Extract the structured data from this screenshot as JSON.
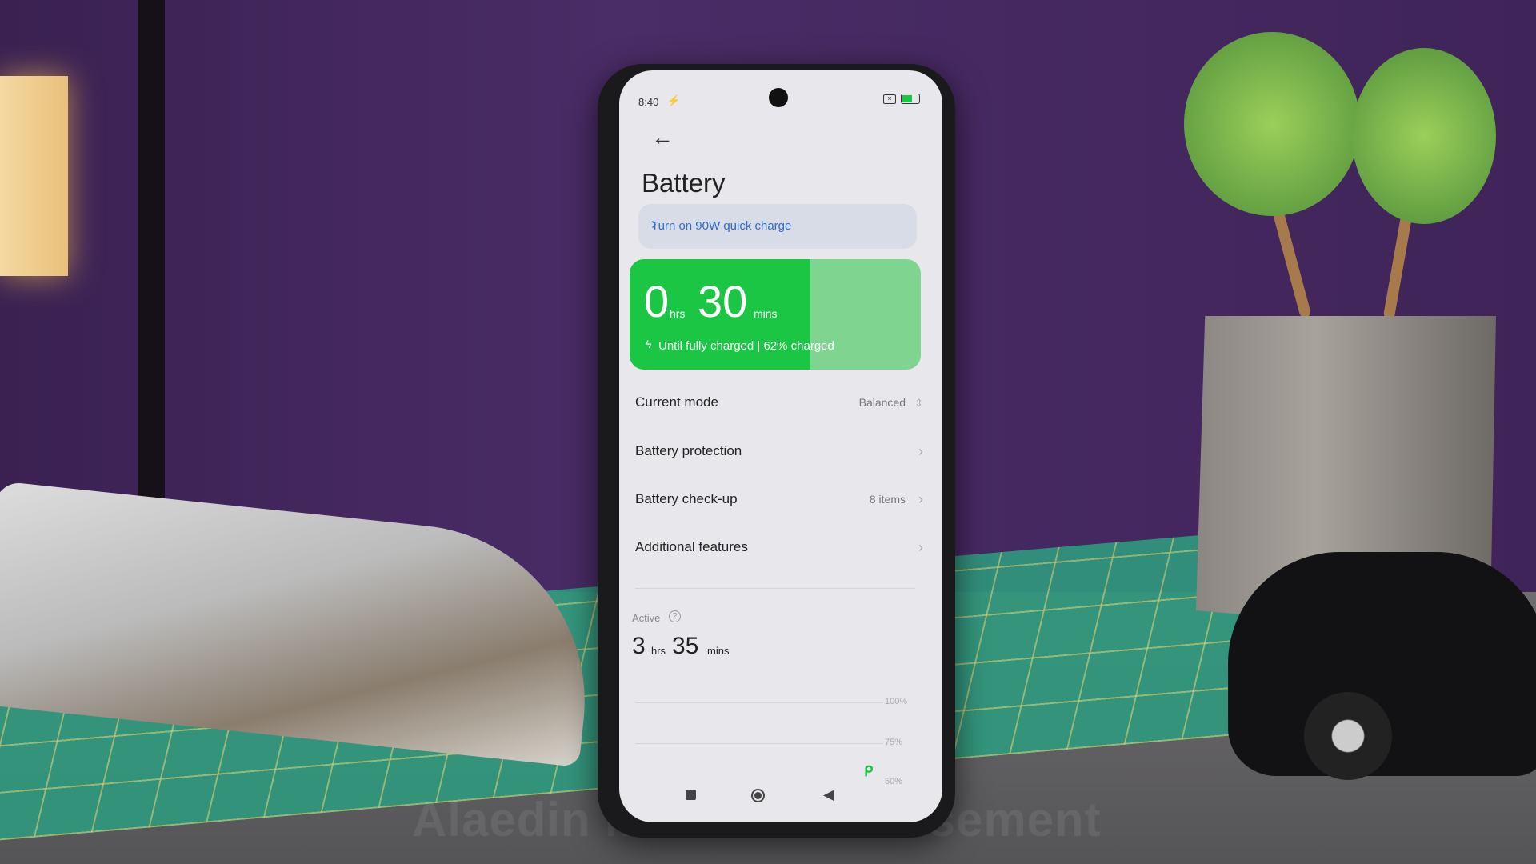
{
  "status_bar": {
    "time": "8:40",
    "battery_level": "62"
  },
  "page": {
    "title": "Battery"
  },
  "banner": {
    "label": "Turn on 90W quick charge"
  },
  "charge_card": {
    "hours": "0",
    "hours_unit": "hrs",
    "minutes": "30",
    "minutes_unit": "mins",
    "subtitle": "Until fully charged | 62% charged",
    "percent": 62,
    "fill_color": "#1cc645",
    "rest_color": "#7fd48f"
  },
  "rows": [
    {
      "label": "Current mode",
      "value": "Balanced"
    },
    {
      "label": "Battery protection",
      "value": ""
    },
    {
      "label": "Battery check-up",
      "value": "8 items"
    },
    {
      "label": "Additional features",
      "value": ""
    }
  ],
  "active": {
    "label": "Active",
    "hours": "3",
    "hours_unit": "hrs",
    "minutes": "35",
    "minutes_unit": "mins"
  },
  "usage_chart": {
    "levels": [
      "100%",
      "75%",
      "50%"
    ]
  },
  "watermark": "Alaedin Media Advertisement"
}
